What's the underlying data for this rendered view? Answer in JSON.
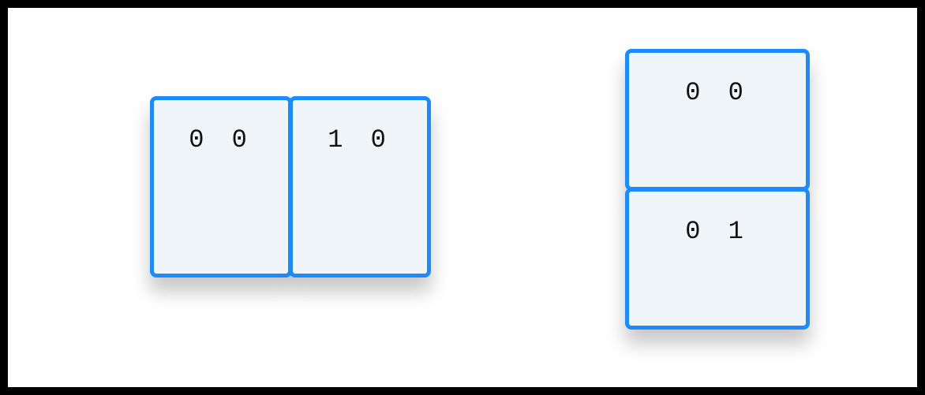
{
  "diagram": {
    "left_group": {
      "orientation": "horizontal",
      "cells": [
        {
          "label": "0 0"
        },
        {
          "label": "1 0"
        }
      ]
    },
    "right_group": {
      "orientation": "vertical",
      "cells": [
        {
          "label": "0 0"
        },
        {
          "label": "0 1"
        }
      ]
    },
    "colors": {
      "border": "#1a8cff",
      "fill": "#f0f5fa",
      "canvas_border": "#000000"
    }
  }
}
